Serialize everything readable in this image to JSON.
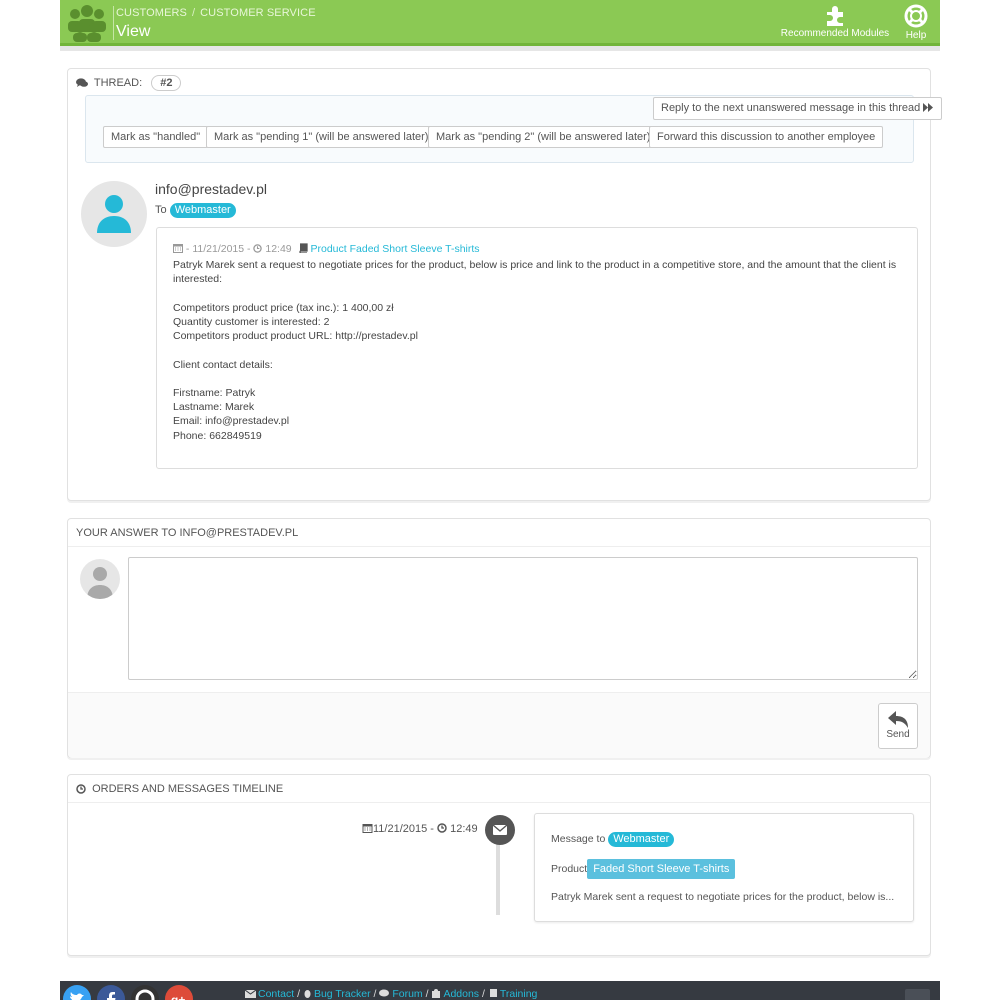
{
  "header": {
    "breadcrumb": [
      "CUSTOMERS",
      "CUSTOMER SERVICE"
    ],
    "title": "View",
    "recommended_modules": "Recommended Modules",
    "help": "Help",
    "brand_color": "#8bc954"
  },
  "thread": {
    "label": "THREAD:",
    "badge": "#2",
    "reply_next_button": "Reply to the next unanswered message in this thread",
    "actions": [
      "Mark as \"handled\"",
      "Mark as \"pending 1\" (will be answered later)",
      "Mark as \"pending 2\" (will be answered later)",
      "Forward this discussion to another employee"
    ],
    "from": "info@prestadev.pl",
    "to_label": "To",
    "to_value": "Webmaster",
    "message": {
      "date": "- 11/21/2015 -",
      "time": "12:49",
      "product_link": "Product Faded Short Sleeve T-shirts",
      "lines": [
        "Patryk Marek sent a request to negotiate prices for the product, below is price and link to the product in a competitive store, and the amount that the client is interested:",
        "",
        "Competitors product price (tax inc.): 1 400,00 zł",
        "Quantity customer is interested: 2",
        "Competitors product product URL: http://prestadev.pl",
        "",
        "Client contact details:",
        "",
        "Firstname: Patryk",
        "Lastname: Marek",
        "Email: info@prestadev.pl",
        "Phone: 662849519"
      ]
    }
  },
  "answer": {
    "heading": "YOUR ANSWER TO INFO@PRESTADEV.PL",
    "textarea_value": "",
    "send_label": "Send"
  },
  "timeline": {
    "heading": "ORDERS AND MESSAGES TIMELINE",
    "date": "11/21/2015 -",
    "time": "12:49",
    "message_to_label": "Message to",
    "message_to_value": "Webmaster",
    "product_label": "Product",
    "product_value": "Faded Short Sleeve T-shirts",
    "excerpt": "Patryk Marek sent a request to negotiate prices for the product, below is..."
  },
  "footer": {
    "social": [
      "twitter-icon",
      "facebook-icon",
      "github-icon",
      "google-plus-icon"
    ],
    "links": [
      "Contact",
      "Bug Tracker",
      "Forum",
      "Addons",
      "Training"
    ]
  },
  "colors": {
    "accent_blue": "#25b9d7",
    "footer_bg": "#363a41"
  }
}
